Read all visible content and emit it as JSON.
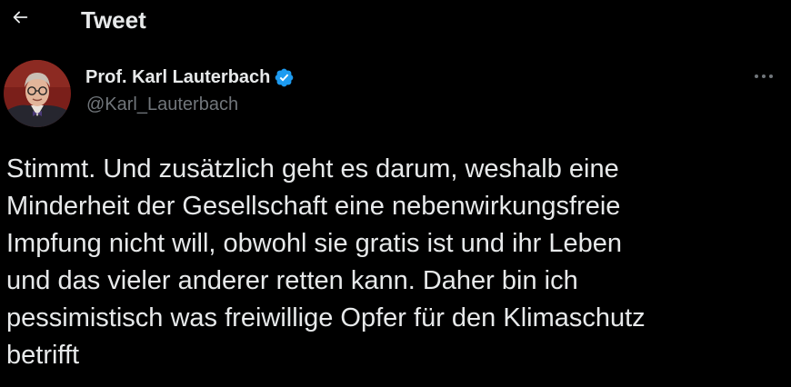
{
  "header": {
    "title": "Tweet",
    "back_icon": "arrow-left-icon"
  },
  "author": {
    "display_name": "Prof. Karl Lauterbach",
    "handle": "@Karl_Lauterbach",
    "verified_icon": "verified-badge-icon",
    "verified_color": "#1d9bf0"
  },
  "more_icon": "ellipsis-icon",
  "tweet": {
    "lines": [
      "Stimmt. Und zusätzlich geht es darum, weshalb eine",
      "Minderheit der Gesellschaft eine nebenwirkungsfreie",
      "Impfung nicht will, obwohl sie gratis ist und ihr Leben",
      "und das vieler anderer retten kann. Daher bin ich",
      "pessimistisch was freiwillige Opfer für den Klimaschutz",
      "betrifft"
    ]
  },
  "colors": {
    "background": "#000000",
    "text": "#e7e9ea",
    "secondary": "#71767b",
    "accent": "#1d9bf0"
  }
}
